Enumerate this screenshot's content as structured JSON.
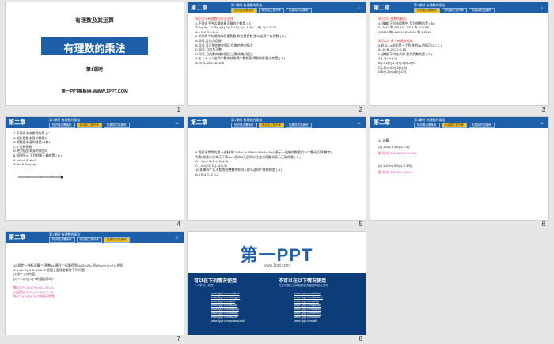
{
  "chapter_label": "第二章",
  "lesson_label": "第1课时 有理数的乘法",
  "tabs": [
    "知识要点基础练",
    "综合能力提升练",
    "拓展探究突破练"
  ],
  "slide1": {
    "number": "1",
    "topic": "有理数及其运算",
    "title": "有理数的乘法",
    "subtitle": "第1课时",
    "footer": "第一PPT模板网-WWW.1PPT.COM"
  },
  "slide2": {
    "number": "2",
    "page": "-2-",
    "lines": [
      {
        "t": "知识点1  有理数的乘法法则",
        "c": "red"
      },
      {
        "t": "1.下列式子中运算结果正确的个数是 ( B )",
        "c": ""
      },
      {
        "t": "①3×(-4)=-12;②(-4)×(-6)=24;③(-3)×(-1/3)=-1;④(-2)×12=24",
        "c": ""
      },
      {
        "t": "A.1        B.2        C.3        D.4",
        "c": ""
      },
      {
        "t": "2.如果两个有理数的积是负数,和也是负数,那么这两个有理数 ( D )",
        "c": ""
      },
      {
        "t": "A.同号,且均为负数",
        "c": ""
      },
      {
        "t": "B.异号,且正数的绝对值比负数的绝对值大",
        "c": ""
      },
      {
        "t": "C.同号,且均为正数",
        "c": ""
      },
      {
        "t": "D.异号,且负数的绝对值比正数的绝对值大",
        "c": ""
      },
      {
        "t": "3.在-2,3,-4,-5这四个数中任取两个数相乘,得到的积最大的是 ( A )",
        "c": ""
      },
      {
        "t": "A.20       B.-20       C.10       D.8",
        "c": ""
      }
    ]
  },
  "slide3": {
    "number": "3",
    "page": "-3-",
    "lines": [
      {
        "t": "知识点2  倒数的概念",
        "c": "red"
      },
      {
        "t": "4.(改编)下列各组数中,互为倒数的是 ( B )",
        "c": ""
      },
      {
        "t": "A.-2019 和 2019     B.-2019 和 -1/2019",
        "c": ""
      },
      {
        "t": "C.2019 和 -1/2019     D.-2019 和 1/2019",
        "c": ""
      },
      {
        "t": "",
        "c": ""
      },
      {
        "t": "知识点3  多个有理数相乘",
        "c": "red"
      },
      {
        "t": "5.若-3,3,a的积是一个负数,则 a 的值可以 ( C )",
        "c": ""
      },
      {
        "t": "A.-15        B.-2        C.0        D.15",
        "c": ""
      },
      {
        "t": "6.(改编)下列各式中,积为负数的是 ( D )",
        "c": ""
      },
      {
        "t": "A.(-2)×3×(-4)",
        "c": ""
      },
      {
        "t": "B.(-3.2)×(-1.7)×(-3)×(-2)×0",
        "c": ""
      },
      {
        "t": "C.(-5)×(-6)×(-2)×(-3)",
        "c": ""
      },
      {
        "t": "D.6×(-3)×(-8)×(-1/2)",
        "c": ""
      }
    ]
  },
  "slide4": {
    "number": "4",
    "page": "-4-",
    "lines": [
      {
        "t": "7.下列说法中错误的是 ( C )",
        "c": ""
      },
      {
        "t": "A.相反数是本身的数是0",
        "c": ""
      },
      {
        "t": "B.倒数是本身的数是±1和1",
        "c": ""
      },
      {
        "t": "C.0 没有倒数",
        "c": ""
      },
      {
        "t": "D.绝对值是本身的数是0",
        "c": ""
      },
      {
        "t": "8.如图所示,下列判断正确的是 ( B )",
        "c": ""
      },
      {
        "t": "A.a+b>0        B.ab<0",
        "c": ""
      },
      {
        "t": "C.ab>0        D.|b|<|a|",
        "c": ""
      }
    ]
  },
  "slide5": {
    "number": "5",
    "page": "-5-",
    "lines": [
      {
        "t": "9.我们平常用的是十进制,如 2639=2×10³+6×10²+3×10+9,表示十进制的数要用10个数码(又叫数字)",
        "c": ""
      },
      {
        "t": "为数,如果水位每天下降4cm,那么3天后的水位变化用算式表示正确的是 ( C )",
        "c": ""
      },
      {
        "t": "A.(+4)×(+3)    B.(+4)×(-3)",
        "c": ""
      },
      {
        "t": "C.(-4)×(+3)    D.(-4)×(-3)",
        "c": ""
      },
      {
        "t": "10.如果四个互不相等的整数的积为4,那么这四个数的和是 ( A )",
        "c": ""
      },
      {
        "t": "A.0        B.4        C.-2        D.2",
        "c": ""
      }
    ]
  },
  "slide6": {
    "number": "6",
    "page": "-6-",
    "lines": [
      {
        "t": "11.计算:",
        "c": ""
      },
      {
        "t": "(1) 1.6×(-1 3/8)×(-2.5);",
        "c": ""
      },
      {
        "t": "解:原式=1.6×11/8×2.5=11/2",
        "c": "pink"
      },
      {
        "t": "",
        "c": ""
      },
      {
        "t": "(2) 1 2/3×(-5/6)×(-3 3/5);",
        "c": ""
      },
      {
        "t": "解:原式=5/3×5/6×18/5=5",
        "c": "pink"
      }
    ]
  },
  "slide7": {
    "number": "7",
    "page": "-7-",
    "lines": [
      {
        "t": "12.规定一种新运算\"*\",两数a,b通过\"*\"运算得到(a+2)×2-b,即a*b=(a+2)×2-b,例如",
        "c": ""
      },
      {
        "t": "3*5=(3+2)×2-5=10-5=5.根据上面规定解答下列问题:",
        "c": ""
      },
      {
        "t": "(1)求7*(-3)的值;",
        "c": ""
      },
      {
        "t": "(2)7*(-3)与(-3)*7的值相等吗?",
        "c": ""
      },
      {
        "t": "",
        "c": ""
      },
      {
        "t": "解:(1)7*(-3)=(7+2)×2-(-3)=21.",
        "c": "pink"
      },
      {
        "t": "(2)因为(-3)*7=(-3+2)×2-7=-9,",
        "c": "pink"
      },
      {
        "t": "所以7*(-3)与(-3)*7的值不相等.",
        "c": "pink"
      }
    ]
  },
  "slide8": {
    "number": "8",
    "brand": "第一PPT",
    "brand_url": "www.1ppt.com",
    "can_title": "可以在下列情况使用",
    "cannot_title": "不可以在以下情况使用",
    "can_desc": "个人学习、研究",
    "cannot_desc": "在任何第三方网站和发布者的网站上发布",
    "links_left": [
      "www.1ppt.com/moban/",
      "www.1ppt.com/hangye/",
      "www.1ppt.com/jieri/",
      "www.1ppt.com/sucai/",
      "www.1ppt.com/beijing/",
      "www.1ppt.com/tubiao/",
      "www.1ppt.com/xiazai/",
      "www.1ppt.com/powerpoint/"
    ],
    "links_right": [
      "www.1ppt.com/ziliao/",
      "www.1ppt.com/fanwen/",
      "www.1ppt.com/shiti/",
      "www.1ppt.com/jiaoan/",
      "www.1ppt.com/kejian/",
      "www.1ppt.com/excel/",
      "www.1ppt.com/word/",
      "www.1ppt.com/ziti/"
    ]
  }
}
